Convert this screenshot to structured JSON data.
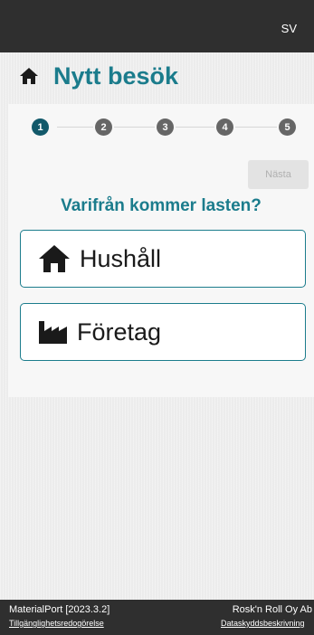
{
  "header": {
    "language": "SV"
  },
  "page": {
    "title": "Nytt besök"
  },
  "stepper": {
    "steps": [
      "1",
      "2",
      "3",
      "4",
      "5"
    ],
    "active_step": 1
  },
  "actions": {
    "next_label": "Nästa"
  },
  "question": {
    "text": "Varifrån kommer lasten?"
  },
  "choices": [
    {
      "label": "Hushåll",
      "icon": "home-icon"
    },
    {
      "label": "Företag",
      "icon": "factory-icon"
    }
  ],
  "footer": {
    "app_version": "MaterialPort [2023.3.2]",
    "company": "Rosk'n Roll Oy Ab",
    "accessibility_link": "Tillgänglighetsredogörelse",
    "privacy_link": "Dataskyddsbeskrivning"
  },
  "colors": {
    "accent": "#1b7c8c",
    "topbar": "#2f2f2f",
    "step_active": "#12596a",
    "step_inactive": "#666666"
  }
}
